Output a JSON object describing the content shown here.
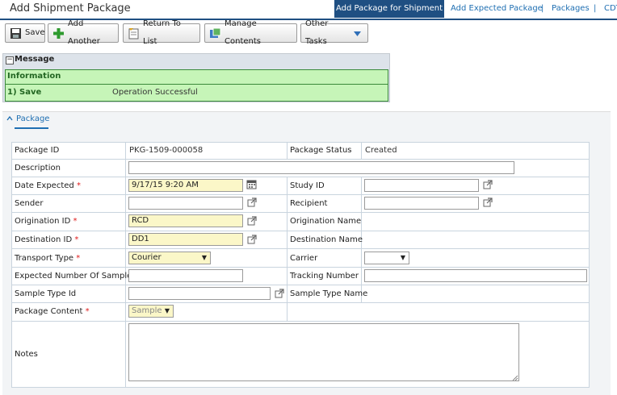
{
  "header": {
    "title": "Add Shipment Package",
    "nav": [
      {
        "label": "Add Package for Shipment",
        "active": true
      },
      {
        "label": "Add Expected Package"
      },
      {
        "label": "Packages"
      },
      {
        "label": "CDT"
      }
    ],
    "separator": "|"
  },
  "toolbar": {
    "save": "Save",
    "add_another": "Add Another",
    "return_to_list": "Return To List",
    "manage_contents": "Manage Contents",
    "other_tasks": "Other Tasks"
  },
  "message": {
    "title": "Message",
    "collapse_glyph": "−",
    "info_label": "Information",
    "item_label": "1) Save",
    "item_text": "Operation Successful"
  },
  "section": {
    "caret": "^",
    "tab_label": "Package"
  },
  "form": {
    "package_id": {
      "label": "Package ID",
      "value": "PKG-1509-000058"
    },
    "package_status": {
      "label": "Package Status",
      "value": "Created"
    },
    "description": {
      "label": "Description",
      "value": ""
    },
    "date_expected": {
      "label": "Date Expected",
      "value": "9/17/15 9:20 AM"
    },
    "study_id": {
      "label": "Study ID",
      "value": ""
    },
    "sender": {
      "label": "Sender",
      "value": ""
    },
    "recipient": {
      "label": "Recipient",
      "value": ""
    },
    "origination_id": {
      "label": "Origination ID",
      "value": "RCD"
    },
    "origination_name": {
      "label": "Origination Name",
      "value": ""
    },
    "destination_id": {
      "label": "Destination ID",
      "value": "DD1"
    },
    "destination_name": {
      "label": "Destination Name",
      "value": ""
    },
    "transport_type": {
      "label": "Transport Type",
      "value": "Courier"
    },
    "carrier": {
      "label": "Carrier",
      "value": ""
    },
    "expected_samples": {
      "label": "Expected Number Of Samples",
      "value": ""
    },
    "tracking_number": {
      "label": "Tracking Number",
      "value": ""
    },
    "sample_type_id": {
      "label": "Sample Type Id",
      "value": ""
    },
    "sample_type_name": {
      "label": "Sample Type Name",
      "value": ""
    },
    "package_content": {
      "label": "Package Content",
      "value": "Sample"
    },
    "notes": {
      "label": "Notes",
      "value": ""
    },
    "required_mark": "*"
  },
  "colors": {
    "nav_active_bg": "#1f4f82",
    "link": "#1f6fb2",
    "info_green": "#c6f5b8",
    "required_input": "#fbf7c8",
    "required_star": "#e01b1b"
  }
}
